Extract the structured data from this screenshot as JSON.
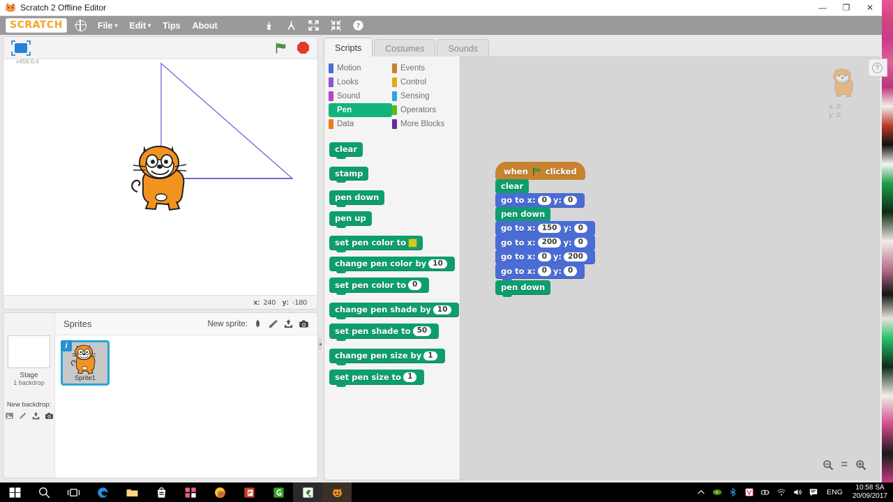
{
  "window": {
    "title": "Scratch 2 Offline Editor",
    "app_icon": "scratch-cat-icon",
    "minimize": "—",
    "maximize": "❐",
    "close": "✕"
  },
  "menubar": {
    "logo": "SCRATCH",
    "globe_icon": "globe-icon",
    "items": [
      {
        "label": "File",
        "has_caret": true
      },
      {
        "label": "Edit",
        "has_caret": true
      },
      {
        "label": "Tips",
        "has_caret": false
      },
      {
        "label": "About",
        "has_caret": false
      }
    ],
    "caret": "▾",
    "tools": [
      {
        "name": "duplicate-icon"
      },
      {
        "name": "cut-icon"
      },
      {
        "name": "grow-icon"
      },
      {
        "name": "shrink-icon"
      },
      {
        "name": "block-help-icon"
      }
    ]
  },
  "stage": {
    "presentation_button": "presentation-mode-icon",
    "version": "v456.0.4",
    "green_flag": "green-flag-icon",
    "stop": "stop-sign-icon",
    "coords": {
      "x_label": "x:",
      "x_value": "240",
      "y_label": "y:",
      "y_value": "-180"
    },
    "pen_drawing": {
      "description": "right triangle drawn with pen",
      "line_color": "#7b6fd8",
      "points": [
        [
          226,
          90
        ],
        [
          226,
          255
        ],
        [
          414,
          255
        ],
        [
          226,
          90
        ]
      ]
    }
  },
  "sprite_pane": {
    "stage_label": "Stage",
    "stage_sub": "1 backdrop",
    "new_backdrop_label": "New backdrop:",
    "backdrop_icons": [
      "library-icon",
      "paint-icon",
      "upload-icon",
      "camera-icon"
    ],
    "sprites_title": "Sprites",
    "new_sprite_label": "New sprite:",
    "new_sprite_icons": [
      "library-icon",
      "paint-icon",
      "upload-icon",
      "camera-icon"
    ],
    "sprites": [
      {
        "name": "Sprite1",
        "selected": true,
        "badge": "i"
      }
    ]
  },
  "editor": {
    "tabs": [
      {
        "label": "Scripts",
        "active": true
      },
      {
        "label": "Costumes",
        "active": false
      },
      {
        "label": "Sounds",
        "active": false
      }
    ],
    "categories_left": [
      {
        "label": "Motion",
        "color": "#4a6cd4",
        "selected": false
      },
      {
        "label": "Looks",
        "color": "#8a55d7",
        "selected": false
      },
      {
        "label": "Sound",
        "color": "#bb42c3",
        "selected": false
      },
      {
        "label": "Pen",
        "color": "#0e9e6e",
        "selected": true
      },
      {
        "label": "Data",
        "color": "#ee7d16",
        "selected": false
      }
    ],
    "categories_right": [
      {
        "label": "Events",
        "color": "#c88330",
        "selected": false
      },
      {
        "label": "Control",
        "color": "#e1a91a",
        "selected": false
      },
      {
        "label": "Sensing",
        "color": "#2ca5e2",
        "selected": false
      },
      {
        "label": "Operators",
        "color": "#5cb712",
        "selected": false
      },
      {
        "label": "More Blocks",
        "color": "#632d99",
        "selected": false
      }
    ],
    "palette_blocks": [
      {
        "id": "clear",
        "parts": [
          {
            "t": "text",
            "v": "clear"
          }
        ]
      },
      {
        "id": "stamp",
        "parts": [
          {
            "t": "text",
            "v": "stamp"
          }
        ]
      },
      {
        "id": "pen-down",
        "parts": [
          {
            "t": "text",
            "v": "pen down"
          }
        ]
      },
      {
        "id": "pen-up",
        "parts": [
          {
            "t": "text",
            "v": "pen up"
          }
        ]
      },
      {
        "id": "set-pen-color-to-color",
        "parts": [
          {
            "t": "text",
            "v": "set pen color to"
          },
          {
            "t": "color",
            "v": "#c8cc2a"
          }
        ]
      },
      {
        "id": "change-pen-color-by",
        "parts": [
          {
            "t": "text",
            "v": "change pen color by"
          },
          {
            "t": "oval",
            "v": "10"
          }
        ]
      },
      {
        "id": "set-pen-color-to-num",
        "parts": [
          {
            "t": "text",
            "v": "set pen color to"
          },
          {
            "t": "oval",
            "v": "0"
          }
        ]
      },
      {
        "id": "change-pen-shade-by",
        "parts": [
          {
            "t": "text",
            "v": "change pen shade by"
          },
          {
            "t": "oval",
            "v": "10"
          }
        ]
      },
      {
        "id": "set-pen-shade-to",
        "parts": [
          {
            "t": "text",
            "v": "set pen shade to"
          },
          {
            "t": "oval",
            "v": "50"
          }
        ]
      },
      {
        "id": "change-pen-size-by",
        "parts": [
          {
            "t": "text",
            "v": "change pen size by"
          },
          {
            "t": "oval",
            "v": "1"
          }
        ]
      },
      {
        "id": "set-pen-size-to",
        "parts": [
          {
            "t": "text",
            "v": "set pen size to"
          },
          {
            "t": "oval",
            "v": "1"
          }
        ]
      }
    ],
    "script": {
      "hat": {
        "pre": "when",
        "post": "clicked",
        "flag": "green-flag-icon"
      },
      "blocks": [
        {
          "id": "clear",
          "cat": "pen",
          "parts": [
            {
              "t": "text",
              "v": "clear"
            }
          ]
        },
        {
          "id": "go-to-xy-1",
          "cat": "motion",
          "parts": [
            {
              "t": "text",
              "v": "go to x:"
            },
            {
              "t": "oval",
              "v": "0"
            },
            {
              "t": "text",
              "v": "y:"
            },
            {
              "t": "oval",
              "v": "0"
            }
          ]
        },
        {
          "id": "pen-down-1",
          "cat": "pen",
          "parts": [
            {
              "t": "text",
              "v": "pen down"
            }
          ]
        },
        {
          "id": "go-to-xy-2",
          "cat": "motion",
          "parts": [
            {
              "t": "text",
              "v": "go to x:"
            },
            {
              "t": "oval",
              "v": "150"
            },
            {
              "t": "text",
              "v": "y:"
            },
            {
              "t": "oval",
              "v": "0"
            }
          ]
        },
        {
          "id": "go-to-xy-3",
          "cat": "motion",
          "parts": [
            {
              "t": "text",
              "v": "go to x:"
            },
            {
              "t": "oval",
              "v": "200"
            },
            {
              "t": "text",
              "v": "y:"
            },
            {
              "t": "oval",
              "v": "0"
            }
          ]
        },
        {
          "id": "go-to-xy-4",
          "cat": "motion",
          "parts": [
            {
              "t": "text",
              "v": "go to x:"
            },
            {
              "t": "oval",
              "v": "0"
            },
            {
              "t": "text",
              "v": "y:"
            },
            {
              "t": "oval",
              "v": "200"
            }
          ]
        },
        {
          "id": "go-to-xy-5",
          "cat": "motion",
          "parts": [
            {
              "t": "text",
              "v": "go to x:"
            },
            {
              "t": "oval",
              "v": "0"
            },
            {
              "t": "text",
              "v": "y:"
            },
            {
              "t": "oval",
              "v": "0"
            }
          ]
        },
        {
          "id": "pen-down-2",
          "cat": "pen",
          "parts": [
            {
              "t": "text",
              "v": "pen down"
            }
          ]
        }
      ]
    },
    "watermark": {
      "x_label": "x:",
      "x_value": "0",
      "y_label": "y:",
      "y_value": "0"
    },
    "zoom_controls": [
      {
        "name": "zoom-out-icon",
        "label": ""
      },
      {
        "name": "zoom-reset-icon",
        "label": "="
      },
      {
        "name": "zoom-in-icon",
        "label": ""
      }
    ],
    "help_icon": "help-question-icon"
  },
  "taskbar": {
    "items": [
      {
        "name": "start-button"
      },
      {
        "name": "search-icon"
      },
      {
        "name": "task-view-icon"
      },
      {
        "name": "edge-icon"
      },
      {
        "name": "file-explorer-icon"
      },
      {
        "name": "microsoft-store-icon"
      },
      {
        "name": "office-icon"
      },
      {
        "name": "firefox-icon"
      },
      {
        "name": "powerpoint-icon"
      },
      {
        "name": "app-green-c-icon"
      },
      {
        "name": "app-green-c-active-icon"
      },
      {
        "name": "scratch-taskbar-icon"
      }
    ],
    "tray": [
      {
        "name": "show-hidden-icons-icon"
      },
      {
        "name": "nvidia-icon"
      },
      {
        "name": "bluetooth-icon"
      },
      {
        "name": "antivirus-icon"
      },
      {
        "name": "battery-icon"
      },
      {
        "name": "wifi-icon"
      },
      {
        "name": "volume-icon"
      },
      {
        "name": "notifications-icon"
      }
    ],
    "language": "ENG",
    "time": "10:58 SA",
    "date": "20/09/2017"
  }
}
